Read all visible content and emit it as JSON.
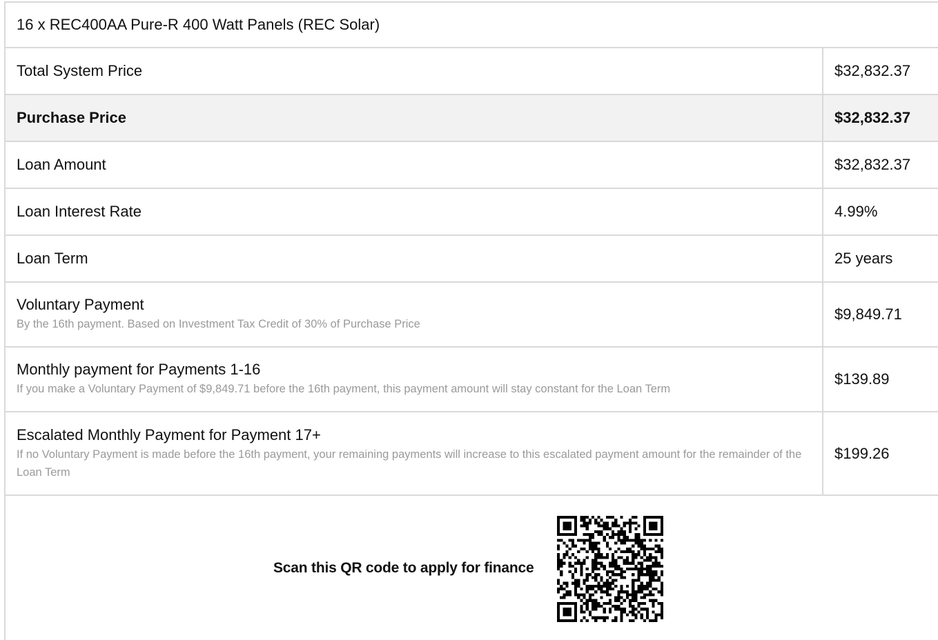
{
  "header": {
    "title": "16 x REC400AA Pure-R 400 Watt Panels (REC Solar)"
  },
  "rows": [
    {
      "label": "Total System Price",
      "sub": "",
      "value": "$32,832.37"
    },
    {
      "label": "Purchase Price",
      "sub": "",
      "value": "$32,832.37"
    },
    {
      "label": "Loan Amount",
      "sub": "",
      "value": "$32,832.37"
    },
    {
      "label": "Loan Interest Rate",
      "sub": "",
      "value": "4.99%"
    },
    {
      "label": "Loan Term",
      "sub": "",
      "value": "25 years"
    },
    {
      "label": "Voluntary Payment",
      "sub": "By the 16th payment. Based on Investment Tax Credit of 30% of Purchase Price",
      "value": "$9,849.71"
    },
    {
      "label": "Monthly payment for Payments 1-16",
      "sub": "If you make a Voluntary Payment of $9,849.71 before the 16th payment, this payment amount will stay constant for the Loan Term",
      "value": "$139.89"
    },
    {
      "label": "Escalated Monthly Payment for Payment 17+",
      "sub": "If no Voluntary Payment is made before the 16th payment, your remaining payments will increase to this escalated payment amount for the remainder of the Loan Term",
      "value": "$199.26"
    }
  ],
  "qr": {
    "caption": "Scan this QR code to apply for finance",
    "icon": "qr-code-icon"
  }
}
